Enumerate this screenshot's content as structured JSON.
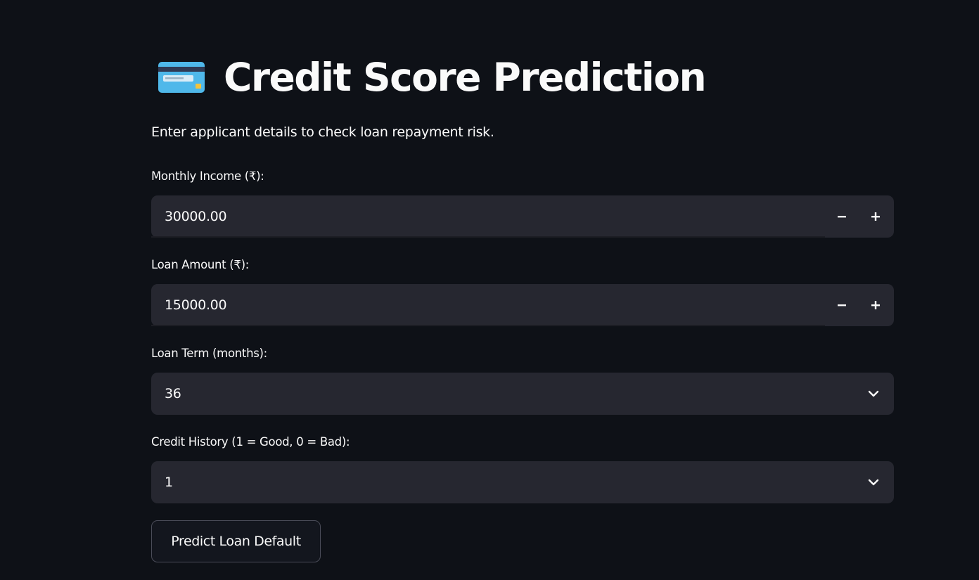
{
  "header": {
    "icon": "credit-card-icon",
    "title": "Credit Score Prediction",
    "subtitle": "Enter applicant details to check loan repayment risk."
  },
  "form": {
    "monthly_income": {
      "label": "Monthly Income (₹):",
      "value": "30000.00"
    },
    "loan_amount": {
      "label": "Loan Amount (₹):",
      "value": "15000.00"
    },
    "loan_term": {
      "label": "Loan Term (months):",
      "selected": "36"
    },
    "credit_history": {
      "label": "Credit History (1 = Good, 0 = Bad):",
      "selected": "1"
    },
    "submit_label": "Predict Loan Default"
  },
  "colors": {
    "background": "#0e1117",
    "input_bg": "#262730",
    "text": "#fafafa",
    "card_blue": "#4fb8ea",
    "card_chip": "#f5c33b"
  }
}
